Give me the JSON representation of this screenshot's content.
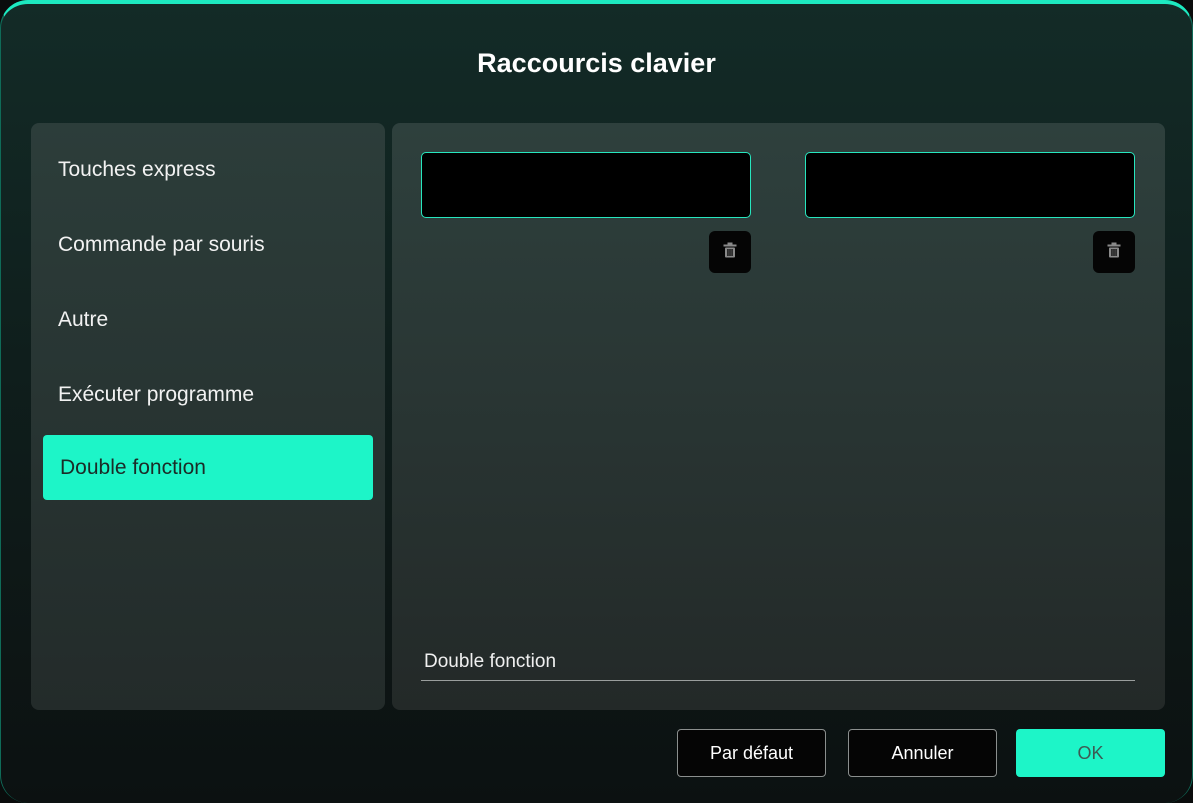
{
  "dialog": {
    "title": "Raccourcis clavier"
  },
  "sidebar": {
    "items": [
      {
        "label": "Touches express",
        "active": false
      },
      {
        "label": "Commande par souris",
        "active": false
      },
      {
        "label": "Autre",
        "active": false
      },
      {
        "label": "Exécuter programme",
        "active": false
      },
      {
        "label": "Double fonction",
        "active": true
      }
    ]
  },
  "main": {
    "key_fields": [
      {
        "value": "",
        "placeholder": ""
      },
      {
        "value": "",
        "placeholder": ""
      }
    ],
    "delete_icon": "trash-icon",
    "bottom_label": "Double fonction"
  },
  "footer": {
    "default_label": "Par défaut",
    "cancel_label": "Annuler",
    "ok_label": "OK"
  },
  "colors": {
    "accent": "#1df5c8",
    "field_border": "#27e6be",
    "background": "#0f1e1c"
  }
}
